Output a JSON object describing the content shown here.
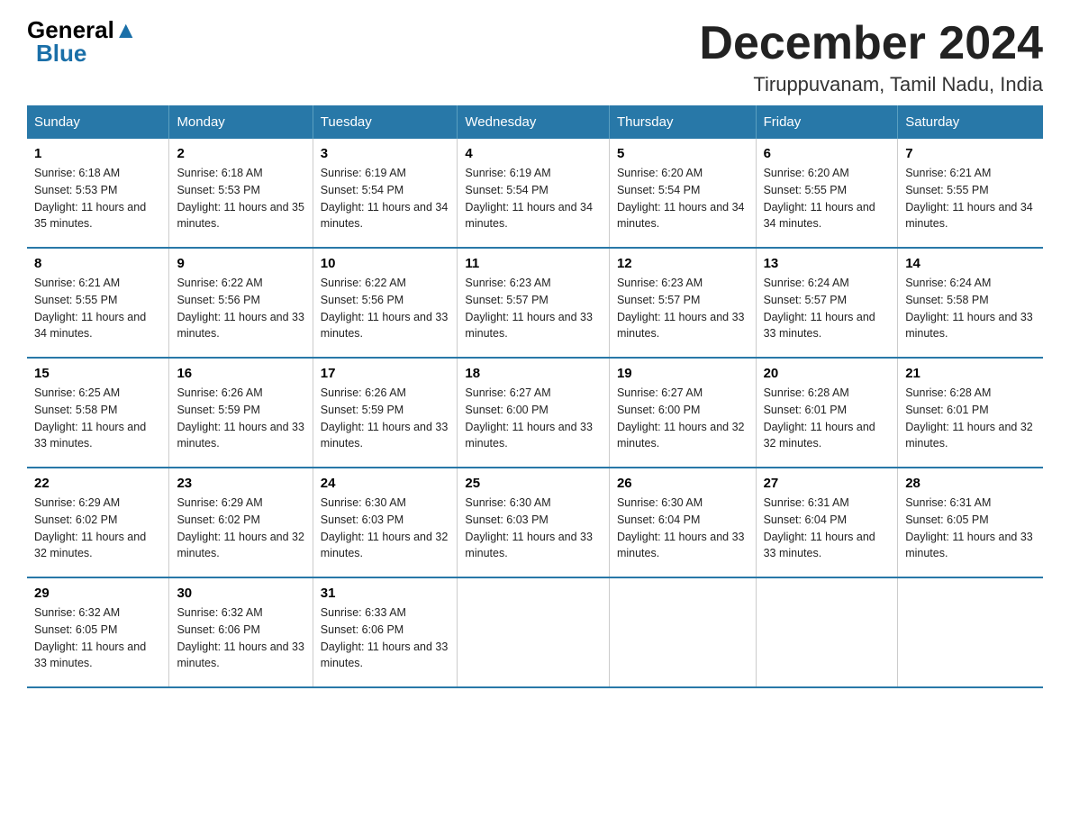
{
  "logo": {
    "general": "General",
    "blue": "Blue",
    "triangle": "▲"
  },
  "title": "December 2024",
  "subtitle": "Tiruppuvanam, Tamil Nadu, India",
  "days_header": [
    "Sunday",
    "Monday",
    "Tuesday",
    "Wednesday",
    "Thursday",
    "Friday",
    "Saturday"
  ],
  "weeks": [
    [
      {
        "day": "1",
        "sunrise": "6:18 AM",
        "sunset": "5:53 PM",
        "daylight": "11 hours and 35 minutes."
      },
      {
        "day": "2",
        "sunrise": "6:18 AM",
        "sunset": "5:53 PM",
        "daylight": "11 hours and 35 minutes."
      },
      {
        "day": "3",
        "sunrise": "6:19 AM",
        "sunset": "5:54 PM",
        "daylight": "11 hours and 34 minutes."
      },
      {
        "day": "4",
        "sunrise": "6:19 AM",
        "sunset": "5:54 PM",
        "daylight": "11 hours and 34 minutes."
      },
      {
        "day": "5",
        "sunrise": "6:20 AM",
        "sunset": "5:54 PM",
        "daylight": "11 hours and 34 minutes."
      },
      {
        "day": "6",
        "sunrise": "6:20 AM",
        "sunset": "5:55 PM",
        "daylight": "11 hours and 34 minutes."
      },
      {
        "day": "7",
        "sunrise": "6:21 AM",
        "sunset": "5:55 PM",
        "daylight": "11 hours and 34 minutes."
      }
    ],
    [
      {
        "day": "8",
        "sunrise": "6:21 AM",
        "sunset": "5:55 PM",
        "daylight": "11 hours and 34 minutes."
      },
      {
        "day": "9",
        "sunrise": "6:22 AM",
        "sunset": "5:56 PM",
        "daylight": "11 hours and 33 minutes."
      },
      {
        "day": "10",
        "sunrise": "6:22 AM",
        "sunset": "5:56 PM",
        "daylight": "11 hours and 33 minutes."
      },
      {
        "day": "11",
        "sunrise": "6:23 AM",
        "sunset": "5:57 PM",
        "daylight": "11 hours and 33 minutes."
      },
      {
        "day": "12",
        "sunrise": "6:23 AM",
        "sunset": "5:57 PM",
        "daylight": "11 hours and 33 minutes."
      },
      {
        "day": "13",
        "sunrise": "6:24 AM",
        "sunset": "5:57 PM",
        "daylight": "11 hours and 33 minutes."
      },
      {
        "day": "14",
        "sunrise": "6:24 AM",
        "sunset": "5:58 PM",
        "daylight": "11 hours and 33 minutes."
      }
    ],
    [
      {
        "day": "15",
        "sunrise": "6:25 AM",
        "sunset": "5:58 PM",
        "daylight": "11 hours and 33 minutes."
      },
      {
        "day": "16",
        "sunrise": "6:26 AM",
        "sunset": "5:59 PM",
        "daylight": "11 hours and 33 minutes."
      },
      {
        "day": "17",
        "sunrise": "6:26 AM",
        "sunset": "5:59 PM",
        "daylight": "11 hours and 33 minutes."
      },
      {
        "day": "18",
        "sunrise": "6:27 AM",
        "sunset": "6:00 PM",
        "daylight": "11 hours and 33 minutes."
      },
      {
        "day": "19",
        "sunrise": "6:27 AM",
        "sunset": "6:00 PM",
        "daylight": "11 hours and 32 minutes."
      },
      {
        "day": "20",
        "sunrise": "6:28 AM",
        "sunset": "6:01 PM",
        "daylight": "11 hours and 32 minutes."
      },
      {
        "day": "21",
        "sunrise": "6:28 AM",
        "sunset": "6:01 PM",
        "daylight": "11 hours and 32 minutes."
      }
    ],
    [
      {
        "day": "22",
        "sunrise": "6:29 AM",
        "sunset": "6:02 PM",
        "daylight": "11 hours and 32 minutes."
      },
      {
        "day": "23",
        "sunrise": "6:29 AM",
        "sunset": "6:02 PM",
        "daylight": "11 hours and 32 minutes."
      },
      {
        "day": "24",
        "sunrise": "6:30 AM",
        "sunset": "6:03 PM",
        "daylight": "11 hours and 32 minutes."
      },
      {
        "day": "25",
        "sunrise": "6:30 AM",
        "sunset": "6:03 PM",
        "daylight": "11 hours and 33 minutes."
      },
      {
        "day": "26",
        "sunrise": "6:30 AM",
        "sunset": "6:04 PM",
        "daylight": "11 hours and 33 minutes."
      },
      {
        "day": "27",
        "sunrise": "6:31 AM",
        "sunset": "6:04 PM",
        "daylight": "11 hours and 33 minutes."
      },
      {
        "day": "28",
        "sunrise": "6:31 AM",
        "sunset": "6:05 PM",
        "daylight": "11 hours and 33 minutes."
      }
    ],
    [
      {
        "day": "29",
        "sunrise": "6:32 AM",
        "sunset": "6:05 PM",
        "daylight": "11 hours and 33 minutes."
      },
      {
        "day": "30",
        "sunrise": "6:32 AM",
        "sunset": "6:06 PM",
        "daylight": "11 hours and 33 minutes."
      },
      {
        "day": "31",
        "sunrise": "6:33 AM",
        "sunset": "6:06 PM",
        "daylight": "11 hours and 33 minutes."
      },
      null,
      null,
      null,
      null
    ]
  ],
  "labels": {
    "sunrise": "Sunrise: ",
    "sunset": "Sunset: ",
    "daylight": "Daylight: "
  }
}
